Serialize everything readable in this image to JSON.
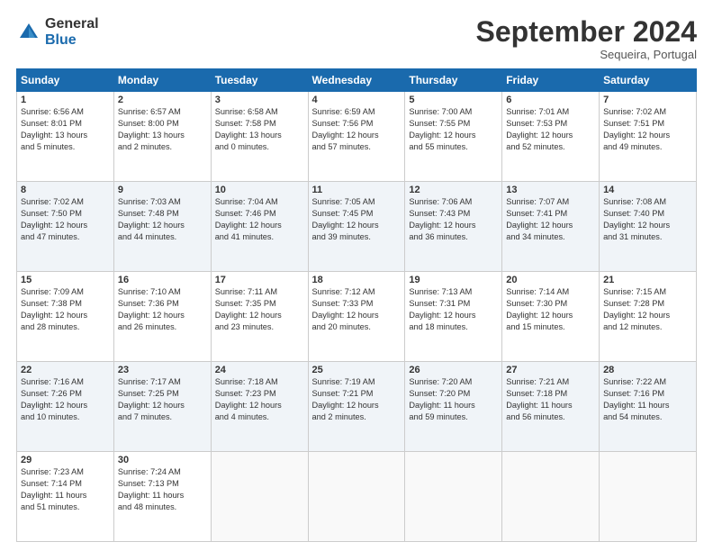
{
  "header": {
    "logo_general": "General",
    "logo_blue": "Blue",
    "month_title": "September 2024",
    "subtitle": "Sequeira, Portugal"
  },
  "weekdays": [
    "Sunday",
    "Monday",
    "Tuesday",
    "Wednesday",
    "Thursday",
    "Friday",
    "Saturday"
  ],
  "weeks": [
    [
      {
        "day": "1",
        "info": "Sunrise: 6:56 AM\nSunset: 8:01 PM\nDaylight: 13 hours\nand 5 minutes."
      },
      {
        "day": "2",
        "info": "Sunrise: 6:57 AM\nSunset: 8:00 PM\nDaylight: 13 hours\nand 2 minutes."
      },
      {
        "day": "3",
        "info": "Sunrise: 6:58 AM\nSunset: 7:58 PM\nDaylight: 13 hours\nand 0 minutes."
      },
      {
        "day": "4",
        "info": "Sunrise: 6:59 AM\nSunset: 7:56 PM\nDaylight: 12 hours\nand 57 minutes."
      },
      {
        "day": "5",
        "info": "Sunrise: 7:00 AM\nSunset: 7:55 PM\nDaylight: 12 hours\nand 55 minutes."
      },
      {
        "day": "6",
        "info": "Sunrise: 7:01 AM\nSunset: 7:53 PM\nDaylight: 12 hours\nand 52 minutes."
      },
      {
        "day": "7",
        "info": "Sunrise: 7:02 AM\nSunset: 7:51 PM\nDaylight: 12 hours\nand 49 minutes."
      }
    ],
    [
      {
        "day": "8",
        "info": "Sunrise: 7:02 AM\nSunset: 7:50 PM\nDaylight: 12 hours\nand 47 minutes."
      },
      {
        "day": "9",
        "info": "Sunrise: 7:03 AM\nSunset: 7:48 PM\nDaylight: 12 hours\nand 44 minutes."
      },
      {
        "day": "10",
        "info": "Sunrise: 7:04 AM\nSunset: 7:46 PM\nDaylight: 12 hours\nand 41 minutes."
      },
      {
        "day": "11",
        "info": "Sunrise: 7:05 AM\nSunset: 7:45 PM\nDaylight: 12 hours\nand 39 minutes."
      },
      {
        "day": "12",
        "info": "Sunrise: 7:06 AM\nSunset: 7:43 PM\nDaylight: 12 hours\nand 36 minutes."
      },
      {
        "day": "13",
        "info": "Sunrise: 7:07 AM\nSunset: 7:41 PM\nDaylight: 12 hours\nand 34 minutes."
      },
      {
        "day": "14",
        "info": "Sunrise: 7:08 AM\nSunset: 7:40 PM\nDaylight: 12 hours\nand 31 minutes."
      }
    ],
    [
      {
        "day": "15",
        "info": "Sunrise: 7:09 AM\nSunset: 7:38 PM\nDaylight: 12 hours\nand 28 minutes."
      },
      {
        "day": "16",
        "info": "Sunrise: 7:10 AM\nSunset: 7:36 PM\nDaylight: 12 hours\nand 26 minutes."
      },
      {
        "day": "17",
        "info": "Sunrise: 7:11 AM\nSunset: 7:35 PM\nDaylight: 12 hours\nand 23 minutes."
      },
      {
        "day": "18",
        "info": "Sunrise: 7:12 AM\nSunset: 7:33 PM\nDaylight: 12 hours\nand 20 minutes."
      },
      {
        "day": "19",
        "info": "Sunrise: 7:13 AM\nSunset: 7:31 PM\nDaylight: 12 hours\nand 18 minutes."
      },
      {
        "day": "20",
        "info": "Sunrise: 7:14 AM\nSunset: 7:30 PM\nDaylight: 12 hours\nand 15 minutes."
      },
      {
        "day": "21",
        "info": "Sunrise: 7:15 AM\nSunset: 7:28 PM\nDaylight: 12 hours\nand 12 minutes."
      }
    ],
    [
      {
        "day": "22",
        "info": "Sunrise: 7:16 AM\nSunset: 7:26 PM\nDaylight: 12 hours\nand 10 minutes."
      },
      {
        "day": "23",
        "info": "Sunrise: 7:17 AM\nSunset: 7:25 PM\nDaylight: 12 hours\nand 7 minutes."
      },
      {
        "day": "24",
        "info": "Sunrise: 7:18 AM\nSunset: 7:23 PM\nDaylight: 12 hours\nand 4 minutes."
      },
      {
        "day": "25",
        "info": "Sunrise: 7:19 AM\nSunset: 7:21 PM\nDaylight: 12 hours\nand 2 minutes."
      },
      {
        "day": "26",
        "info": "Sunrise: 7:20 AM\nSunset: 7:20 PM\nDaylight: 11 hours\nand 59 minutes."
      },
      {
        "day": "27",
        "info": "Sunrise: 7:21 AM\nSunset: 7:18 PM\nDaylight: 11 hours\nand 56 minutes."
      },
      {
        "day": "28",
        "info": "Sunrise: 7:22 AM\nSunset: 7:16 PM\nDaylight: 11 hours\nand 54 minutes."
      }
    ],
    [
      {
        "day": "29",
        "info": "Sunrise: 7:23 AM\nSunset: 7:14 PM\nDaylight: 11 hours\nand 51 minutes."
      },
      {
        "day": "30",
        "info": "Sunrise: 7:24 AM\nSunset: 7:13 PM\nDaylight: 11 hours\nand 48 minutes."
      },
      {
        "day": "",
        "info": ""
      },
      {
        "day": "",
        "info": ""
      },
      {
        "day": "",
        "info": ""
      },
      {
        "day": "",
        "info": ""
      },
      {
        "day": "",
        "info": ""
      }
    ]
  ]
}
